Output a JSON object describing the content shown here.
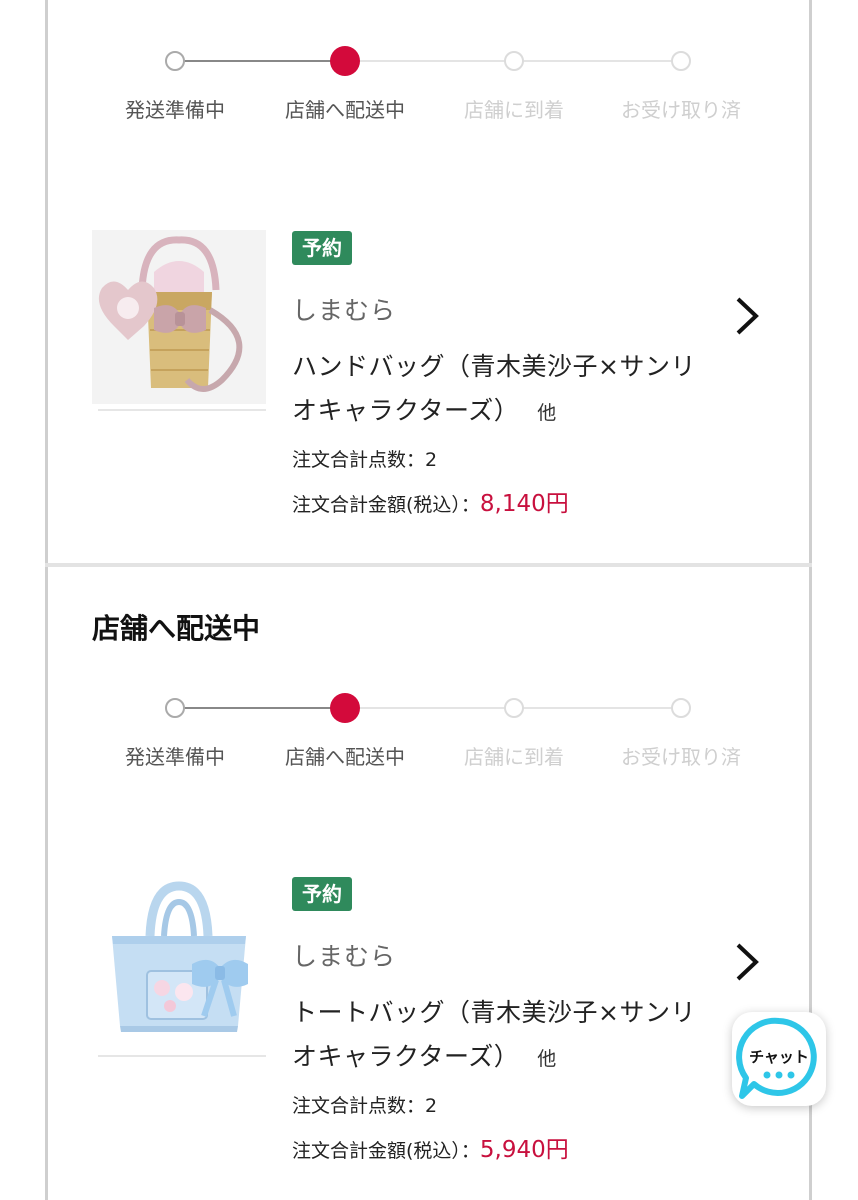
{
  "colors": {
    "accent": "#d30a3b",
    "price": "#c8103e",
    "badge": "#2f8a5c",
    "chat_ring": "#2ec6e8"
  },
  "orders": [
    {
      "steps": [
        "発送準備中",
        "店舗へ配送中",
        "店舗に到着",
        "お受け取り済"
      ],
      "current_step": 1,
      "badge": "予約",
      "shop": "しまむら",
      "product_line1": "ハンドバッグ（青木美沙子×サンリ",
      "product_line2": "オキャラクターズ）",
      "other": "他",
      "count_label": "注文合計点数：",
      "count": "2",
      "total_label": "注文合計金額(税込）：",
      "total": "8,140円"
    },
    {
      "title": "店舗へ配送中",
      "steps": [
        "発送準備中",
        "店舗へ配送中",
        "店舗に到着",
        "お受け取り済"
      ],
      "current_step": 1,
      "badge": "予約",
      "shop": "しまむら",
      "product_line1": "トートバッグ（青木美沙子×サンリ",
      "product_line2": "オキャラクターズ）",
      "other": "他",
      "count_label": "注文合計点数：",
      "count": "2",
      "total_label": "注文合計金額(税込）：",
      "total": "5,940円"
    }
  ],
  "chat": {
    "label": "チャット",
    "icon": "chat-bubble-icon"
  }
}
